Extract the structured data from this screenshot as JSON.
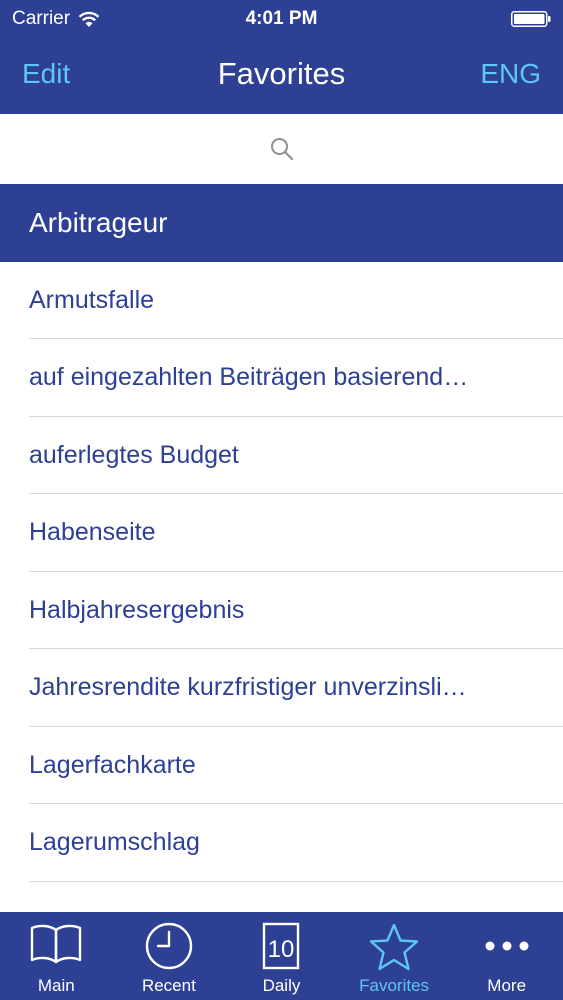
{
  "status": {
    "carrier": "Carrier",
    "time": "4:01 PM"
  },
  "nav": {
    "edit": "Edit",
    "title": "Favorites",
    "lang": "ENG"
  },
  "search": {
    "placeholder": ""
  },
  "items": [
    {
      "label": "Arbitrageur"
    },
    {
      "label": "Armutsfalle"
    },
    {
      "label": "auf eingezahlten Beiträgen basierend…"
    },
    {
      "label": "auferlegtes Budget"
    },
    {
      "label": "Habenseite"
    },
    {
      "label": "Halbjahresergebnis"
    },
    {
      "label": "Jahresrendite kurzfristiger unverzinsli…"
    },
    {
      "label": "Lagerfachkarte"
    },
    {
      "label": "Lagerumschlag"
    }
  ],
  "tabs": [
    {
      "label": "Main",
      "icon": "book-icon"
    },
    {
      "label": "Recent",
      "icon": "clock-icon"
    },
    {
      "label": "Daily",
      "icon": "calendar-icon",
      "day": "10"
    },
    {
      "label": "Favorites",
      "icon": "star-icon"
    },
    {
      "label": "More",
      "icon": "more-icon"
    }
  ],
  "colors": {
    "bar": "#2d4094",
    "accent": "#5ec6f2",
    "item_text": "#2d4094"
  }
}
